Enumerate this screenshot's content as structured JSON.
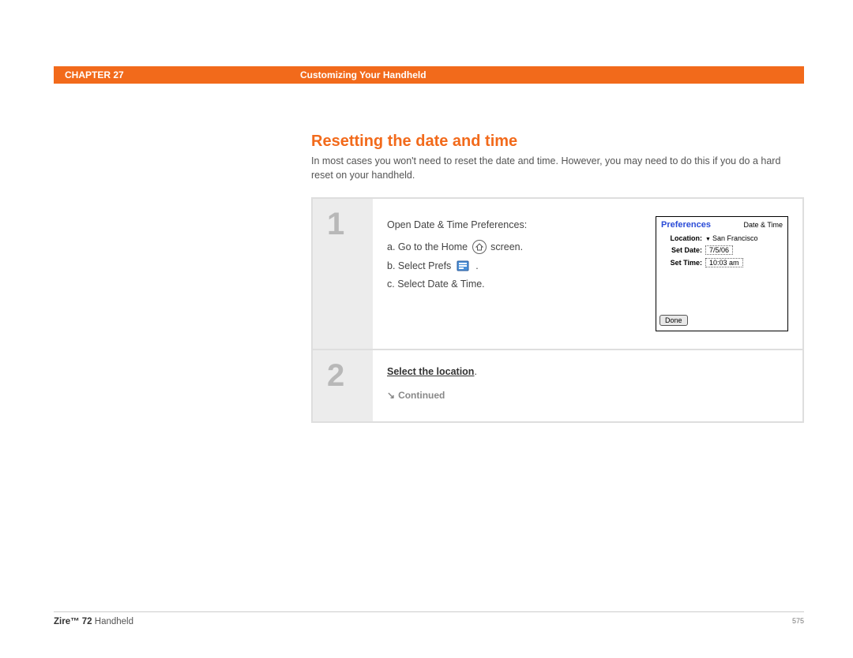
{
  "header": {
    "chapter": "CHAPTER 27",
    "title": "Customizing Your Handheld"
  },
  "section": {
    "title": "Resetting the date and time",
    "desc": "In most cases you won't need to reset the date and time. However, you may need to do this if you do a hard reset on your handheld."
  },
  "steps": {
    "one": {
      "num": "1",
      "lead": "Open Date & Time Preferences:",
      "a_prefix": "a.  Go to the Home ",
      "a_suffix": " screen.",
      "b_prefix": "b.  Select Prefs ",
      "b_suffix": " .",
      "c": "c.  Select Date & Time."
    },
    "two": {
      "num": "2",
      "link": "Select the location",
      "period": ".",
      "continued": "Continued"
    }
  },
  "device": {
    "pref_label": "Preferences",
    "category": "Date & Time",
    "location_lbl": "Location:",
    "location_val": "San Francisco",
    "date_lbl": "Set Date:",
    "date_val": "7/5/06",
    "time_lbl": "Set Time:",
    "time_val": "10:03 am",
    "done": "Done"
  },
  "footer": {
    "product_bold": "Zire™ 72",
    "product_rest": " Handheld",
    "page": "575"
  }
}
